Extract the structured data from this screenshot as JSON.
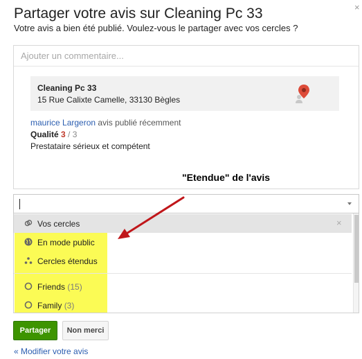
{
  "dialog": {
    "title": "Partager votre avis sur Cleaning Pc 33",
    "subtitle": "Votre avis a bien été publié. Voulez-vous le partager avec vos cercles ?",
    "close_glyph": "×"
  },
  "comment": {
    "placeholder": "Ajouter un commentaire..."
  },
  "place": {
    "name": "Cleaning Pc 33",
    "address": "15 Rue Calixte Camelle, 33130 Bègles",
    "pin_icon": "map-pin-icon",
    "pin_color": "#dd4b39"
  },
  "review": {
    "reviewer": "maurice Largeron",
    "status": " avis publié récemment",
    "rating_label": "Qualité ",
    "rating_value": "3",
    "rating_max": " / 3",
    "text": "Prestataire sérieux et compétent"
  },
  "annotation": {
    "label": "\"Etendue\" de l'avis",
    "arrow_color": "#c0161a"
  },
  "audience": {
    "value": "",
    "options": [
      {
        "label": "Vos cercles",
        "icon": "circles-icon",
        "count": ""
      },
      {
        "label": "En mode public",
        "icon": "globe-icon",
        "count": ""
      },
      {
        "label": "Cercles étendus",
        "icon": "extended-circles-icon",
        "count": ""
      },
      {
        "label": "Friends",
        "icon": "circle-icon",
        "count": "(15)"
      },
      {
        "label": "Family",
        "icon": "circle-icon",
        "count": "(3)"
      }
    ],
    "clear_glyph": "×",
    "highlight_color": "#fbfb55"
  },
  "actions": {
    "share_label": "Partager",
    "cancel_label": "Non merci",
    "edit_link": "« Modifier votre avis",
    "share_color": "#3d9400"
  }
}
